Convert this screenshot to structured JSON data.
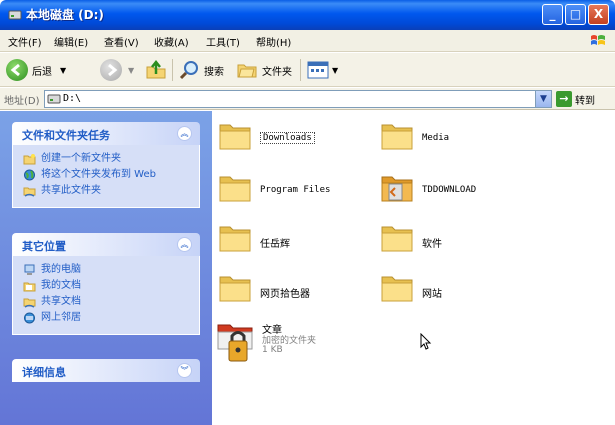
{
  "window": {
    "title": "本地磁盘 (D:)",
    "buttons": {
      "minimize": "_",
      "maximize": "□",
      "close": "X"
    }
  },
  "menu": {
    "items": [
      "文件(F)",
      "编辑(E)",
      "查看(V)",
      "收藏(A)",
      "工具(T)",
      "帮助(H)"
    ]
  },
  "toolbar": {
    "back_label": "后退",
    "search_label": "搜索",
    "folders_label": "文件夹"
  },
  "address": {
    "label": "地址(D)",
    "value": "D:\\",
    "go_label": "转到"
  },
  "sidebar": {
    "panels": [
      {
        "title": "文件和文件夹任务",
        "tasks": [
          "创建一个新文件夹",
          "将这个文件夹发布到 Web",
          "共享此文件夹"
        ]
      },
      {
        "title": "其它位置",
        "tasks": [
          "我的电脑",
          "我的文档",
          "共享文档",
          "网上邻居"
        ]
      },
      {
        "title": "详细信息",
        "tasks": []
      }
    ]
  },
  "files": [
    {
      "name": "Downloads",
      "type": "folder"
    },
    {
      "name": "Media",
      "type": "folder"
    },
    {
      "name": "Program Files",
      "type": "folder"
    },
    {
      "name": "TDDOWNLOAD",
      "type": "folder"
    },
    {
      "name": "任岳辉",
      "type": "folder"
    },
    {
      "name": "软件",
      "type": "folder"
    },
    {
      "name": "网页拾色器",
      "type": "folder"
    },
    {
      "name": "网站",
      "type": "folder"
    },
    {
      "name": "文章",
      "type": "encrypted-folder",
      "description": "加密的文件夹",
      "size": "1 KB"
    }
  ],
  "colors": {
    "titlebar": "#0058ee",
    "sidebar_gradient_top": "#7ba2e7",
    "sidebar_gradient_bottom": "#6375d6",
    "panel_link": "#215dc6",
    "folder": "#f5d472"
  }
}
